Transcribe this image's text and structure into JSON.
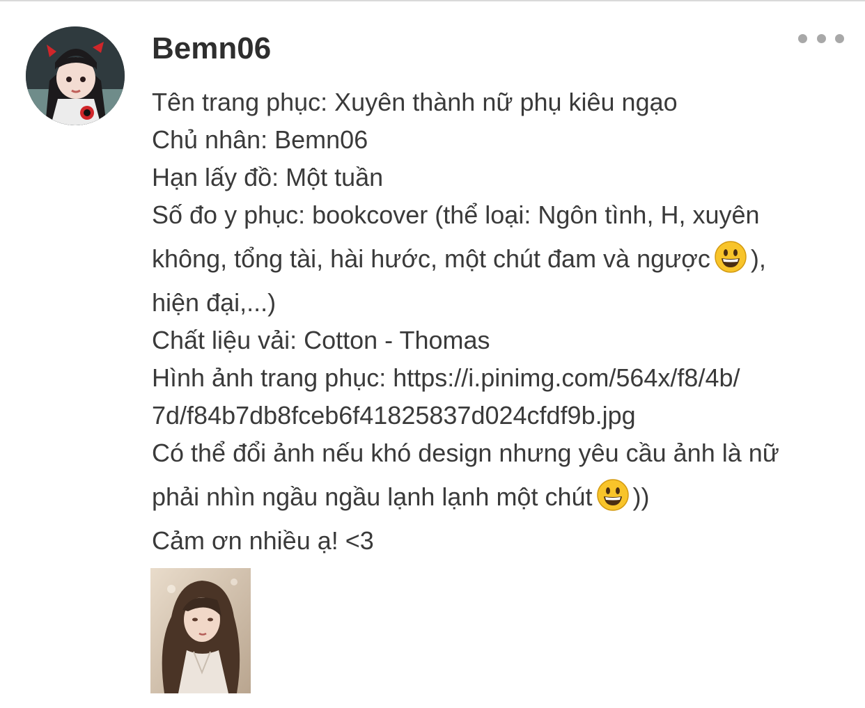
{
  "comment": {
    "username": "Bemn06",
    "lines": [
      "Tên trang phục: Xuyên thành nữ phụ kiêu ngạo",
      "Chủ nhân: Bemn06",
      "Hạn lấy đồ: Một tuần",
      "Số đo y phục: bookcover (thể loại: Ngôn tình, H, xuyên",
      "không, tổng tài, hài hước, một chút đam và ngược",
      "),",
      "hiện đại,...)",
      "Chất liệu vải: Cotton - Thomas",
      "Hình ảnh trang phục: https://i.pinimg.com/564x/f8/4b/",
      "7d/f84b7db8fceb6f41825837d024cfdf9b.jpg",
      "Có thể đổi ảnh nếu khó design nhưng yêu cầu ảnh là nữ",
      "phải nhìn ngầu ngầu lạnh lạnh một chút",
      "))",
      "Cảm ơn nhiều ạ! <3"
    ],
    "emoji_icon": "grinning-face-emoji",
    "more_icon": "more-dots-icon",
    "avatar_icon": "user-avatar",
    "attachment_icon": "attached-image-thumbnail"
  },
  "colors": {
    "text": "#3a3a3a",
    "username": "#2e2e2e",
    "dots": "#a8a8a8",
    "emoji": "#f8c42a"
  }
}
